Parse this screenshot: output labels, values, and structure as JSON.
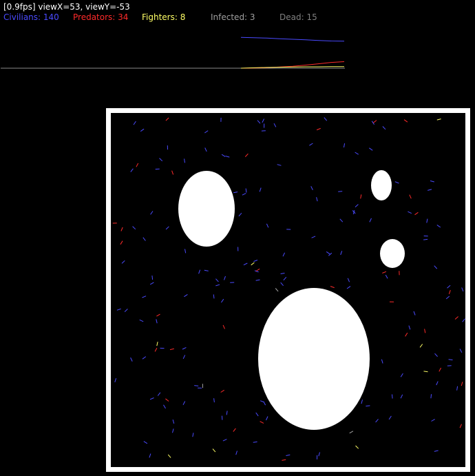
{
  "hud": {
    "fps": "0.9",
    "view_x": "53",
    "view_y": "-53",
    "status_text": "[0.9fps] viewX=53, viewY=-53"
  },
  "stats": {
    "civilians": {
      "label": "Civilians: 140",
      "count": 140,
      "color": "#4a4aff"
    },
    "predators": {
      "label": "Predators: 34",
      "count": 34,
      "color": "#ff2a2a"
    },
    "fighters": {
      "label": "Fighters: 8",
      "count": 8,
      "color": "#ffff66"
    },
    "infected": {
      "label": "Infected: 3",
      "count": 3,
      "color": "#a0a0a0"
    },
    "dead": {
      "label": "Dead: 15",
      "count": 15,
      "color": "#808080"
    }
  },
  "colors": {
    "background": "#000000",
    "arena_border": "#ffffff",
    "obstacle": "#ffffff"
  },
  "history_graph": {
    "series": [
      {
        "name": "civilians",
        "color": "#4a4aff",
        "values": [
          160,
          158,
          156,
          153,
          150,
          147,
          144,
          141,
          140
        ]
      },
      {
        "name": "predators",
        "color": "#ff2a2a",
        "values": [
          0,
          1,
          3,
          6,
          10,
          16,
          23,
          30,
          34
        ]
      },
      {
        "name": "fighters",
        "color": "#ffff66",
        "values": [
          0,
          2,
          4,
          5,
          6,
          7,
          7,
          8,
          8
        ]
      }
    ]
  }
}
